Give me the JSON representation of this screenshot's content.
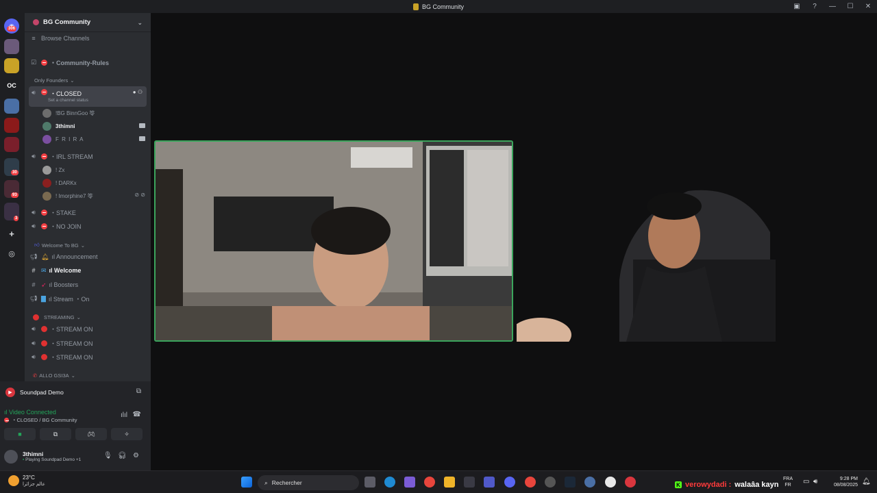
{
  "window": {
    "title": "BG Community"
  },
  "guilds": [
    {
      "id": "discord-home",
      "badge": "306"
    },
    {
      "id": "server-2"
    },
    {
      "id": "server-3"
    },
    {
      "id": "server-oc",
      "label": "OC"
    },
    {
      "id": "server-5"
    },
    {
      "id": "server-6"
    },
    {
      "id": "server-7"
    },
    {
      "id": "folder-1",
      "badge": "30"
    },
    {
      "id": "folder-2",
      "badge": "93"
    },
    {
      "id": "folder-3",
      "badge": "3"
    }
  ],
  "sidebar": {
    "server_name": "BG Community",
    "browse_channels": "Browse Channels",
    "community_rules": "・Community-Rules",
    "categories": {
      "only_founders": "Only Founders",
      "welcome": "Welcome To BG",
      "streaming": "STREAMING",
      "allo": "ALLO GSI3A"
    },
    "voice_channels": {
      "closed": "・CLOSED",
      "closed_status": "Set a channel status",
      "irl_stream": "・IRL STREAM",
      "stake": "・STAKE",
      "no_join": "・NO JOIN"
    },
    "closed_users": [
      "!BG BinnGoo 笭",
      "3thimni",
      "F R I R A"
    ],
    "irl_users": [
      "! Zx",
      "! DARKx",
      "! Imorphine7 笭"
    ],
    "text_channels": {
      "announcement": "ıl Announcement",
      "welcome": "ıl Welcome",
      "boosters": "ıl Boosters",
      "stream_on": "ıl Stream ・On"
    },
    "streaming_channels": [
      "・STREAM ON",
      "・STREAM ON",
      "・STREAM ON"
    ]
  },
  "soundpad": {
    "label": "Soundpad Demo"
  },
  "voice_status": {
    "connected": "Video Connected",
    "location": "・CLOSED / BG Community"
  },
  "user_panel": {
    "name": "3thimni",
    "status": "Playing Soundpad Demo +1"
  },
  "taskbar": {
    "temperature": "23°C",
    "weather_sub": "عالم جزائرا",
    "search_placeholder": "Rechercher",
    "chat_user": "verowydadi :",
    "chat_message": "walaâa kayn",
    "lang_top": "FRA",
    "lang_bottom": "FR",
    "time": "9:28 PM",
    "date": "08/08/2025"
  }
}
